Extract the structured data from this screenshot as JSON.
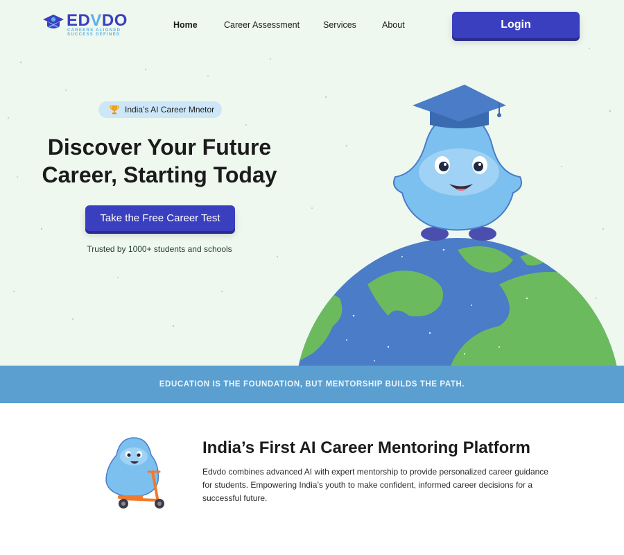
{
  "brand": {
    "name_part1": "ED",
    "name_part2": "V",
    "name_part3": "DO",
    "tagline_line1": "CAREERS ALIGNED",
    "tagline_line2": "SUCCESS DEFINED"
  },
  "nav": {
    "links": [
      {
        "label": "Home",
        "active": true
      },
      {
        "label": "Career Assessment",
        "active": false
      },
      {
        "label": "Services",
        "active": false
      },
      {
        "label": "About",
        "active": false
      }
    ],
    "login_label": "Login"
  },
  "hero": {
    "badge_icon": "trophy-icon",
    "badge_text": "India’s AI Career Mnetor",
    "headline_line1": "Discover Your Future",
    "headline_line2": "Career, Starting Today",
    "cta_label": "Take the Free Career Test",
    "trusted_text": "Trusted by 1000+ students and schools"
  },
  "banner": {
    "text": "EDUCATION IS THE FOUNDATION, BUT MENTORSHIP BUILDS THE PATH."
  },
  "about": {
    "title": "India’s First AI Career Mentoring Platform",
    "description": "Edvdo combines advanced AI with expert mentorship to provide personalized career guidance for students. Empowering India’s youth to make confident, informed career decisions for a successful future."
  },
  "colors": {
    "primary": "#3a3fbf",
    "hero_bg": "#eef8ef",
    "banner_bg": "#5a9fd0",
    "badge_bg": "#cde7f8",
    "mascot_blue": "#7cc0ef",
    "ocean": "#4a7cc7",
    "land": "#6bbb5e"
  }
}
